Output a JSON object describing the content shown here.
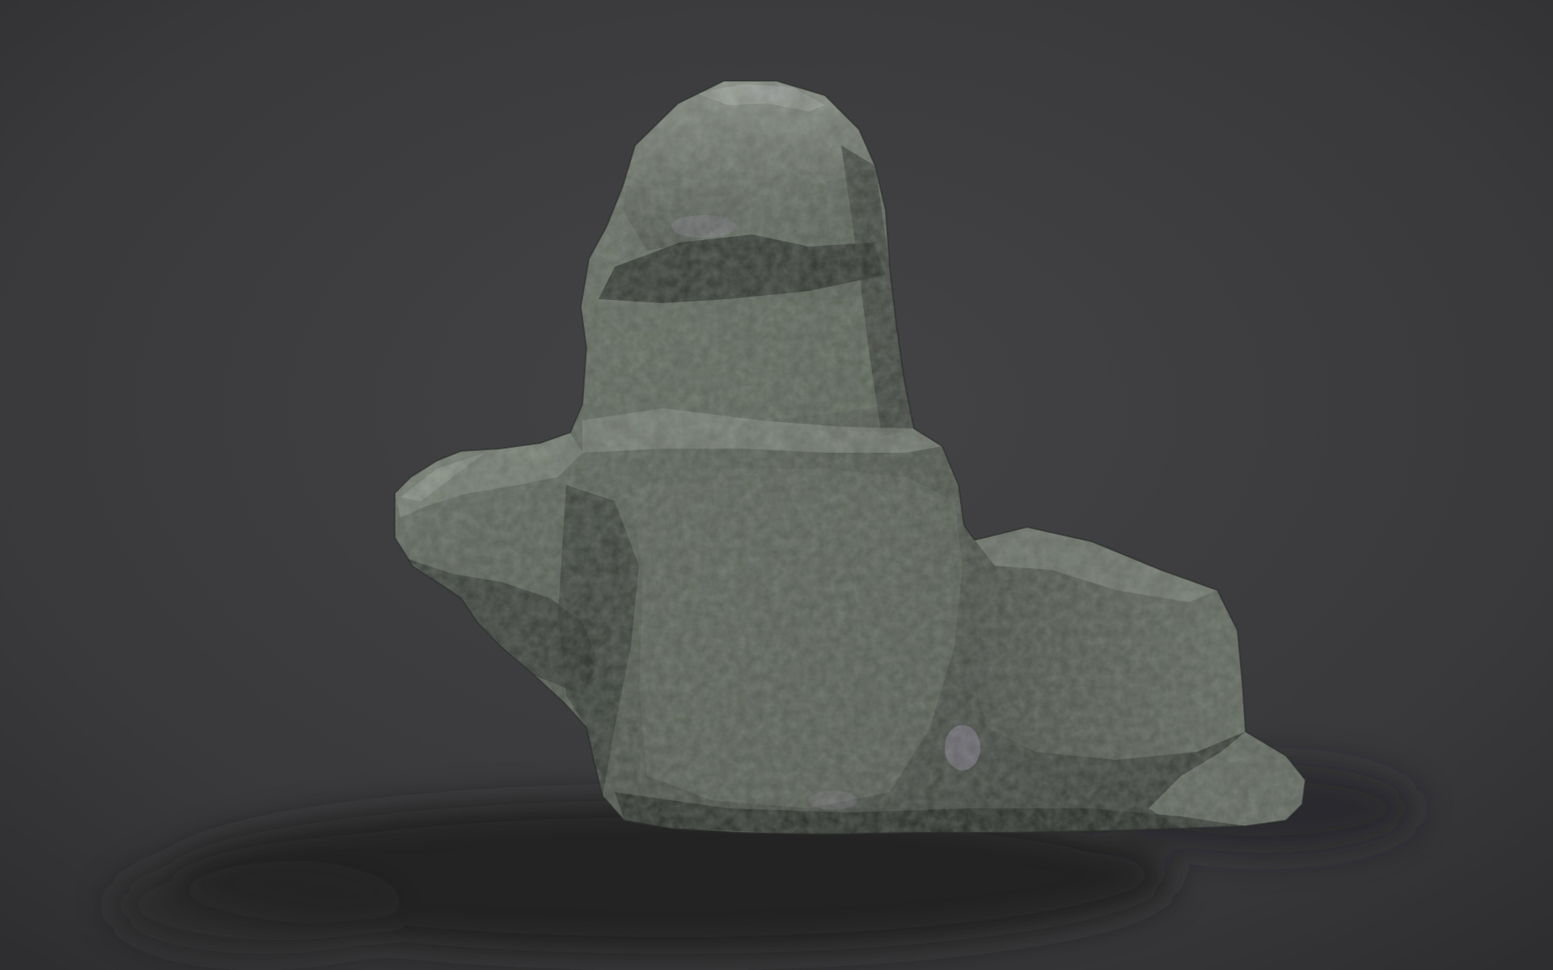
{
  "scene": {
    "subject": "rock",
    "colors": {
      "background": "#3a3a3c",
      "background_light": "#444447",
      "background_dark": "#2e2e30",
      "shadow": "#1e1e20",
      "rock_base": "#5a6158",
      "rock_light": "#8a9286",
      "rock_dark": "#2c302b",
      "rock_highlight": "#b0b6ad",
      "rock_purple_tint": "#8d8497"
    }
  }
}
